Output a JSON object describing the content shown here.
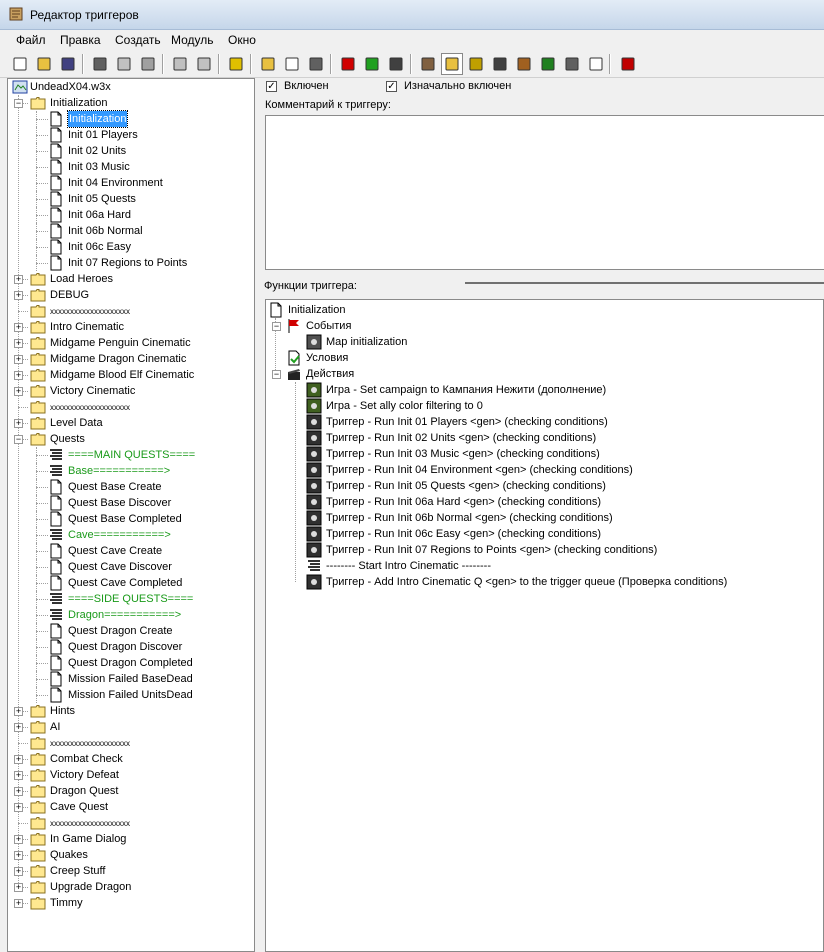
{
  "window": {
    "title": "Редактор триггеров",
    "icon": "scroll-icon"
  },
  "menu": [
    "Файл",
    "Правка",
    "Создать",
    "Модуль",
    "Окно"
  ],
  "toolbar_icons": [
    "new-icon",
    "open-icon",
    "save-icon",
    "cut-icon",
    "copy-icon",
    "paste-icon",
    "undo-icon",
    "redo-icon",
    "delete-icon",
    "new-category-icon",
    "new-trigger-icon",
    "new-comment-icon",
    "new-event-icon",
    "new-condition-icon",
    "new-action-icon",
    "terrain-editor-icon",
    "trigger-editor-icon",
    "sound-editor-icon",
    "object-editor-icon",
    "campaign-editor-icon",
    "ai-editor-icon",
    "object-manager-icon",
    "import-manager-icon",
    "test-map-icon"
  ],
  "left_tree": {
    "root": "UndeadX04.w3x",
    "items": [
      {
        "label": "Initialization",
        "type": "folder",
        "depth": 1,
        "expanded": true
      },
      {
        "label": "Initialization",
        "type": "trigger",
        "depth": 2,
        "selected": true
      },
      {
        "label": "Init 01 Players",
        "type": "trigger",
        "depth": 2
      },
      {
        "label": "Init 02 Units",
        "type": "trigger",
        "depth": 2
      },
      {
        "label": "Init 03 Music",
        "type": "trigger",
        "depth": 2
      },
      {
        "label": "Init 04 Environment",
        "type": "trigger",
        "depth": 2
      },
      {
        "label": "Init 05 Quests",
        "type": "trigger",
        "depth": 2
      },
      {
        "label": "Init 06a Hard",
        "type": "trigger",
        "depth": 2
      },
      {
        "label": "Init 06b Normal",
        "type": "trigger",
        "depth": 2
      },
      {
        "label": "Init 06c Easy",
        "type": "trigger",
        "depth": 2
      },
      {
        "label": "Init 07 Regions to Points",
        "type": "trigger",
        "depth": 2
      },
      {
        "label": "Load Heroes",
        "type": "folder",
        "depth": 1,
        "expandable": true
      },
      {
        "label": "DEBUG",
        "type": "folder",
        "depth": 1,
        "expandable": true
      },
      {
        "label": "xxxxxxxxxxxxxxxxxxxx",
        "type": "folder",
        "depth": 1,
        "small": true
      },
      {
        "label": "Intro Cinematic",
        "type": "folder",
        "depth": 1,
        "expandable": true
      },
      {
        "label": "Midgame Penguin Cinematic",
        "type": "folder",
        "depth": 1,
        "expandable": true
      },
      {
        "label": "Midgame Dragon Cinematic",
        "type": "folder",
        "depth": 1,
        "expandable": true
      },
      {
        "label": "Midgame Blood Elf Cinematic",
        "type": "folder",
        "depth": 1,
        "expandable": true
      },
      {
        "label": "Victory Cinematic",
        "type": "folder",
        "depth": 1,
        "expandable": true
      },
      {
        "label": "xxxxxxxxxxxxxxxxxxxx",
        "type": "folder",
        "depth": 1,
        "small": true
      },
      {
        "label": "Level Data",
        "type": "folder",
        "depth": 1,
        "expandable": true
      },
      {
        "label": "Quests",
        "type": "folder",
        "depth": 1,
        "expanded": true
      },
      {
        "label": "====MAIN QUESTS====",
        "type": "comment",
        "depth": 2
      },
      {
        "label": "Base===========>",
        "type": "comment",
        "depth": 2
      },
      {
        "label": "Quest Base Create",
        "type": "trigger",
        "depth": 2
      },
      {
        "label": "Quest Base Discover",
        "type": "trigger",
        "depth": 2
      },
      {
        "label": "Quest Base Completed",
        "type": "trigger",
        "depth": 2
      },
      {
        "label": "Cave===========>",
        "type": "comment",
        "depth": 2
      },
      {
        "label": "Quest Cave Create",
        "type": "trigger",
        "depth": 2
      },
      {
        "label": "Quest Cave Discover",
        "type": "trigger",
        "depth": 2
      },
      {
        "label": "Quest Cave Completed",
        "type": "trigger",
        "depth": 2
      },
      {
        "label": "====SIDE QUESTS====",
        "type": "comment",
        "depth": 2
      },
      {
        "label": "Dragon===========>",
        "type": "comment",
        "depth": 2
      },
      {
        "label": "Quest Dragon Create",
        "type": "trigger",
        "depth": 2
      },
      {
        "label": "Quest Dragon Discover",
        "type": "trigger",
        "depth": 2
      },
      {
        "label": "Quest Dragon Completed",
        "type": "trigger",
        "depth": 2
      },
      {
        "label": "Mission Failed BaseDead",
        "type": "trigger",
        "depth": 2
      },
      {
        "label": "Mission Failed UnitsDead",
        "type": "trigger",
        "depth": 2
      },
      {
        "label": "Hints",
        "type": "folder",
        "depth": 1,
        "expandable": true
      },
      {
        "label": "AI",
        "type": "folder",
        "depth": 1,
        "expandable": true
      },
      {
        "label": "xxxxxxxxxxxxxxxxxxxx",
        "type": "folder",
        "depth": 1,
        "small": true
      },
      {
        "label": "Combat Check",
        "type": "folder",
        "depth": 1,
        "expandable": true
      },
      {
        "label": "Victory Defeat",
        "type": "folder",
        "depth": 1,
        "expandable": true
      },
      {
        "label": "Dragon Quest",
        "type": "folder",
        "depth": 1,
        "expandable": true
      },
      {
        "label": "Cave Quest",
        "type": "folder",
        "depth": 1,
        "expandable": true
      },
      {
        "label": "xxxxxxxxxxxxxxxxxxxx",
        "type": "folder",
        "depth": 1,
        "small": true
      },
      {
        "label": "In Game Dialog",
        "type": "folder",
        "depth": 1,
        "expandable": true
      },
      {
        "label": "Quakes",
        "type": "folder",
        "depth": 1,
        "expandable": true
      },
      {
        "label": "Creep Stuff",
        "type": "folder",
        "depth": 1,
        "expandable": true
      },
      {
        "label": "Upgrade Dragon",
        "type": "folder",
        "depth": 1,
        "expandable": true
      },
      {
        "label": "Timmy",
        "type": "folder",
        "depth": 1,
        "expandable": true
      }
    ]
  },
  "trigger_props": {
    "enabled_label": "Включен",
    "enabled": true,
    "initially_on_label": "Изначально включен",
    "initially_on": true,
    "comment_label": "Комментарий к триггеру:",
    "comment": ""
  },
  "functions": {
    "label": "Функции триггера:",
    "root": "Initialization",
    "events_label": "События",
    "events": [
      "Map initialization"
    ],
    "conditions_label": "Условия",
    "actions_label": "Действия",
    "actions": [
      {
        "text": "Игра - Set campaign to Кампания Нежити (дополнение)",
        "icon": "game-icon"
      },
      {
        "text": "Игра - Set ally color filtering to 0",
        "icon": "game-icon"
      },
      {
        "text": "Триггер - Run Init 01 Players <gen> (checking conditions)",
        "icon": "trigger-action-icon"
      },
      {
        "text": "Триггер - Run Init 02 Units <gen> (checking conditions)",
        "icon": "trigger-action-icon"
      },
      {
        "text": "Триггер - Run Init 03 Music <gen> (checking conditions)",
        "icon": "trigger-action-icon"
      },
      {
        "text": "Триггер - Run Init 04 Environment <gen> (checking conditions)",
        "icon": "trigger-action-icon"
      },
      {
        "text": "Триггер - Run Init 05 Quests <gen> (checking conditions)",
        "icon": "trigger-action-icon"
      },
      {
        "text": "Триггер - Run Init 06a Hard <gen> (checking conditions)",
        "icon": "trigger-action-icon"
      },
      {
        "text": "Триггер - Run Init 06b Normal <gen> (checking conditions)",
        "icon": "trigger-action-icon"
      },
      {
        "text": "Триггер - Run Init 06c Easy <gen> (checking conditions)",
        "icon": "trigger-action-icon"
      },
      {
        "text": "Триггер - Run Init 07 Regions to Points <gen> (checking conditions)",
        "icon": "trigger-action-icon"
      },
      {
        "text": "-------- Start Intro Cinematic --------",
        "icon": "comment-icon"
      },
      {
        "text": "Триггер - Add Intro Cinematic Q <gen> to the trigger queue (Проверка conditions)",
        "icon": "trigger-action-icon"
      }
    ]
  }
}
